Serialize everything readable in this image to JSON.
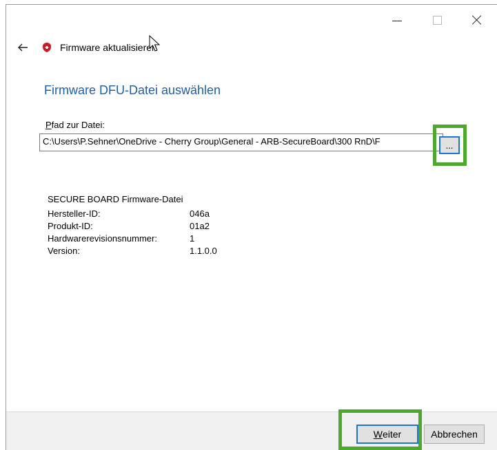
{
  "window": {
    "title": "Firmware aktualisieren",
    "controls": {
      "minimize": "minimize-icon",
      "maximize": "maximize-icon",
      "close": "close-icon"
    }
  },
  "page": {
    "heading": "Firmware DFU-Datei auswählen",
    "path_label_accel": "P",
    "path_label_rest": "fad zur Datei:",
    "path_value": "C:\\Users\\P.Sehner\\OneDrive - Cherry Group\\General - ARB-SecureBoard\\300 RnD\\F",
    "browse_label": "..."
  },
  "file_info": {
    "heading": "SECURE BOARD Firmware-Datei",
    "rows": [
      {
        "key": "Hersteller-ID:",
        "value": "046a"
      },
      {
        "key": "Produkt-ID:",
        "value": "01a2"
      },
      {
        "key": "Hardwarerevisionsnummer:",
        "value": "1"
      },
      {
        "key": "Version:",
        "value": "1.1.0.0"
      }
    ]
  },
  "footer": {
    "next_accel": "W",
    "next_rest": "eiter",
    "cancel_label": "Abbrechen"
  },
  "colors": {
    "accent": "#1c74d6",
    "heading": "#1f5fa8",
    "highlight": "#4fa82e"
  }
}
